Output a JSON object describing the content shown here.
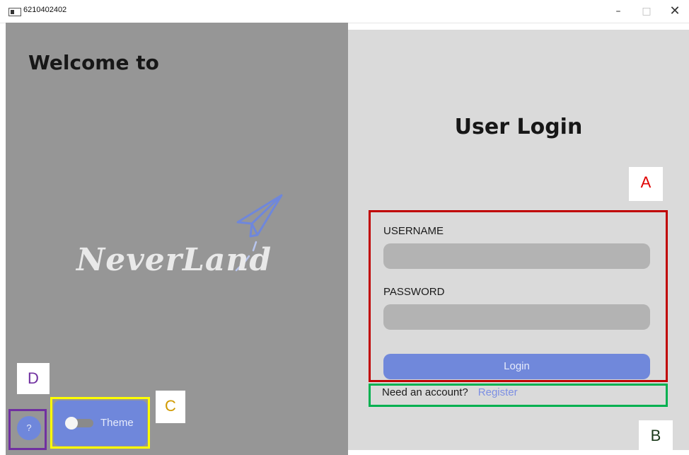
{
  "window": {
    "title": "6210402402",
    "minimize": "–",
    "maximize": "□",
    "close": "✕"
  },
  "left": {
    "welcome": "Welcome to",
    "brand": "NeverLand"
  },
  "login": {
    "title": "User Login",
    "username_label": "USERNAME",
    "username_value": "",
    "password_label": "PASSWORD",
    "password_value": "",
    "login_button": "Login",
    "need_account": "Need an account?",
    "register_link": "Register"
  },
  "controls": {
    "help": "?",
    "theme": "Theme"
  },
  "annotations": {
    "a": "A",
    "b": "B",
    "c": "C",
    "d": "D"
  },
  "colors": {
    "accent": "#6f87db",
    "left_bg": "#969696",
    "right_bg": "#dadada",
    "box_a": "#c00000",
    "box_b": "#00b050",
    "box_c": "#ffff00",
    "box_d": "#7030a0"
  }
}
